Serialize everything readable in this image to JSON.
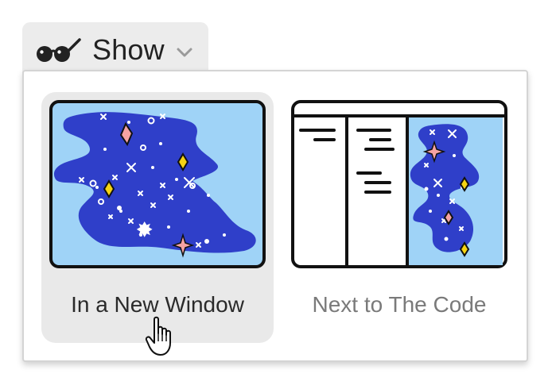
{
  "show_button": {
    "label": "Show",
    "icon": "glasses-icon",
    "dropdown_icon": "chevron-down-icon"
  },
  "menu": {
    "options": [
      {
        "label": "In a New Window",
        "selected": true,
        "thumbnail": "galaxy-window-illustration"
      },
      {
        "label": "Next to The Code",
        "selected": false,
        "thumbnail": "split-editor-illustration"
      }
    ]
  },
  "colors": {
    "thumb_sky": "#9fd3f7",
    "galaxy_blue": "#2f3fc9",
    "yellow_diamond": "#f5d313",
    "pink_diamond": "#f5a3a3",
    "hover_bg": "#e9e9e9",
    "button_bg": "#ececec"
  },
  "cursor": "hand-pointer-icon"
}
